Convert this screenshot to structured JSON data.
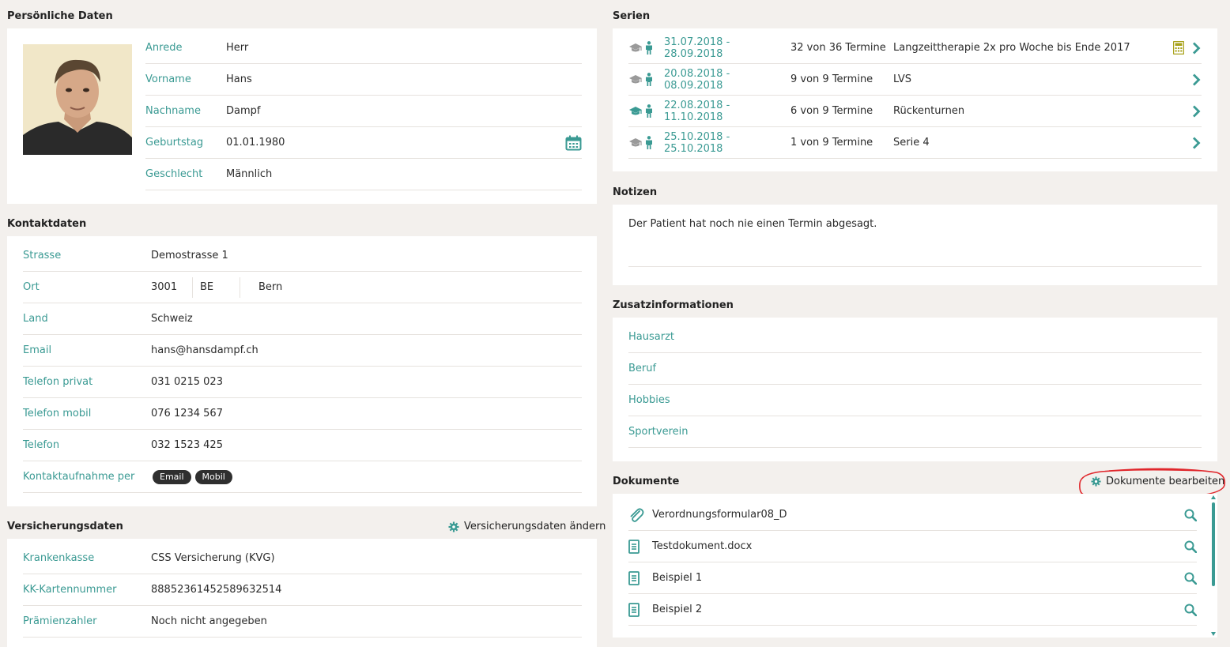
{
  "personal": {
    "title": "Persönliche Daten",
    "fields": [
      {
        "label": "Anrede",
        "value": "Herr"
      },
      {
        "label": "Vorname",
        "value": "Hans"
      },
      {
        "label": "Nachname",
        "value": "Dampf"
      },
      {
        "label": "Geburtstag",
        "value": "01.01.1980"
      },
      {
        "label": "Geschlecht",
        "value": "Männlich"
      }
    ]
  },
  "contact": {
    "title": "Kontaktdaten",
    "strasse_label": "Strasse",
    "strasse": "Demostrasse 1",
    "ort_label": "Ort",
    "plz": "3001",
    "kanton": "BE",
    "ort": "Bern",
    "land_label": "Land",
    "land": "Schweiz",
    "email_label": "Email",
    "email": "hans@hansdampf.ch",
    "tel_privat_label": "Telefon privat",
    "tel_privat": "031 0215 023",
    "tel_mobil_label": "Telefon mobil",
    "tel_mobil": "076 1234 567",
    "tel_label": "Telefon",
    "tel": "032 1523 425",
    "kontakt_label": "Kontaktaufnahme per",
    "kontakt_chips": [
      "Email",
      "Mobil"
    ]
  },
  "insurance": {
    "title": "Versicherungsdaten",
    "edit_label": "Versicherungsdaten ändern",
    "fields": [
      {
        "label": "Krankenkasse",
        "value": "CSS Versicherung (KVG)"
      },
      {
        "label": "KK-Kartennummer",
        "value": "88852361452589632514"
      },
      {
        "label": "Prämienzahler",
        "value": "Noch nicht angegeben"
      }
    ]
  },
  "series": {
    "title": "Serien",
    "items": [
      {
        "dates": "31.07.2018 - 28.09.2018",
        "count": "32 von 36 Termine",
        "name": "Langzeittherapie 2x pro Woche bis Ende 2017",
        "cap_active": false,
        "has_calc": true
      },
      {
        "dates": "20.08.2018 - 08.09.2018",
        "count": "9 von 9 Termine",
        "name": "LVS",
        "cap_active": false,
        "has_calc": false
      },
      {
        "dates": "22.08.2018 - 11.10.2018",
        "count": "6 von 9 Termine",
        "name": "Rückenturnen",
        "cap_active": true,
        "has_calc": false
      },
      {
        "dates": "25.10.2018 - 25.10.2018",
        "count": "1 von 9 Termine",
        "name": "Serie 4",
        "cap_active": false,
        "has_calc": false
      }
    ]
  },
  "notes": {
    "title": "Notizen",
    "text": "Der Patient hat noch nie einen Termin abgesagt."
  },
  "extra": {
    "title": "Zusatzinformationen",
    "fields": [
      "Hausarzt",
      "Beruf",
      "Hobbies",
      "Sportverein"
    ]
  },
  "documents": {
    "title": "Dokumente",
    "edit_label": "Dokumente bearbeiten",
    "items": [
      {
        "name": "Verordnungsformular08_D",
        "icon": "paperclip-icon"
      },
      {
        "name": "Testdokument.docx",
        "icon": "document-icon"
      },
      {
        "name": "Beispiel 1",
        "icon": "document-icon"
      },
      {
        "name": "Beispiel 2",
        "icon": "document-icon"
      }
    ]
  },
  "colors": {
    "teal": "#3a9a93",
    "annotation": "#e0262b",
    "calc": "#a8a21a"
  }
}
